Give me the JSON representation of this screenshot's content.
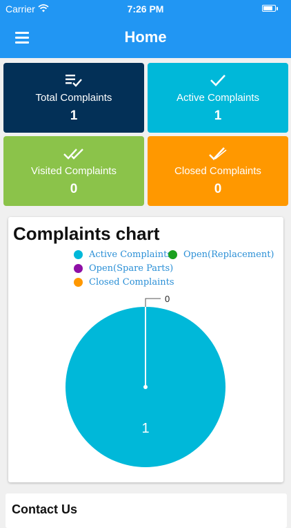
{
  "status_bar": {
    "carrier": "Carrier",
    "time": "7:26 PM",
    "battery_level": 0.8
  },
  "app_bar": {
    "title": "Home"
  },
  "cards": [
    {
      "label": "Total Complaints",
      "value": "1",
      "color": "#033057",
      "icon": "checklist-icon"
    },
    {
      "label": "Active Complaints",
      "value": "1",
      "color": "#00b8d9",
      "icon": "check-icon"
    },
    {
      "label": "Visited Complaints",
      "value": "0",
      "color": "#8bc34a",
      "icon": "double-check-icon"
    },
    {
      "label": "Closed Complaints",
      "value": "0",
      "color": "#ff9800",
      "icon": "check-badge-icon"
    }
  ],
  "chart_section": {
    "title": "Complaints chart",
    "legend": [
      {
        "label": "Active Complaints",
        "color": "#00b8d9"
      },
      {
        "label": "Open(Replacement)",
        "color": "#1aa01e"
      },
      {
        "label": "Open(Spare Parts)",
        "color": "#8e0fa6"
      },
      {
        "label": "Closed Complaints",
        "color": "#ff9800"
      }
    ]
  },
  "chart_data": {
    "type": "pie",
    "title": "Complaints chart",
    "categories": [
      "Active Complaints",
      "Open(Replacement)",
      "Open(Spare Parts)",
      "Closed Complaints"
    ],
    "values": [
      1,
      0,
      0,
      0
    ],
    "colors": [
      "#00b8d9",
      "#1aa01e",
      "#8e0fa6",
      "#ff9800"
    ],
    "data_labels": [
      "1",
      "0"
    ],
    "legend_position": "top"
  },
  "contact": {
    "title": "Contact Us"
  }
}
